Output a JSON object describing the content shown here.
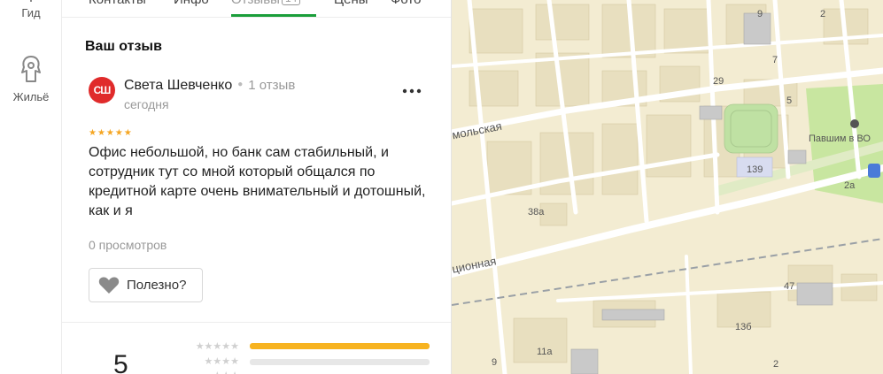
{
  "rail": {
    "gid_label": "Гид",
    "zhile_label": "Жильё"
  },
  "tabs": {
    "contacts": "Контакты",
    "info": "Инфо",
    "reviews": "Отзывы",
    "reviews_count": "14",
    "prices": "Цены",
    "photos": "Фото"
  },
  "review": {
    "section_title": "Ваш отзыв",
    "avatar_initials": "СШ",
    "author": "Света Шевченко",
    "author_reviews": "1 отзыв",
    "date": "сегодня",
    "rating": 5,
    "stars": "★★★★★",
    "text": "Офис небольшой, но банк сам стабильный, и сотрудник тут со мной который общался по кредитной карте очень внимательный и дотошный, как и я",
    "views": "0 просмотров",
    "useful_label": "Полезно?",
    "more_icon": "⋮"
  },
  "summary": {
    "rating": "5",
    "rows": [
      {
        "stars": "★★★★★",
        "fraction": 1.0
      },
      {
        "stars": "★★★★",
        "fraction": 0.0
      },
      {
        "stars": "★★★",
        "fraction": 0.0
      }
    ]
  },
  "map": {
    "labels": {
      "n9": "9",
      "n2": "2",
      "n7": "7",
      "n29": "29",
      "n5": "5",
      "pavshim": "Павшим в ВО",
      "n139": "139",
      "n2a": "2а",
      "n38a": "38а",
      "n47": "47",
      "n13b": "13б",
      "n11a": "11а",
      "n9b": "9",
      "n2b": "2",
      "street1": "мольская",
      "street2": "ционная"
    },
    "colors": {
      "background": "#f3ecd2",
      "road": "#ffffff",
      "park": "#c8e6a0",
      "building": "#e8dfbf"
    }
  }
}
